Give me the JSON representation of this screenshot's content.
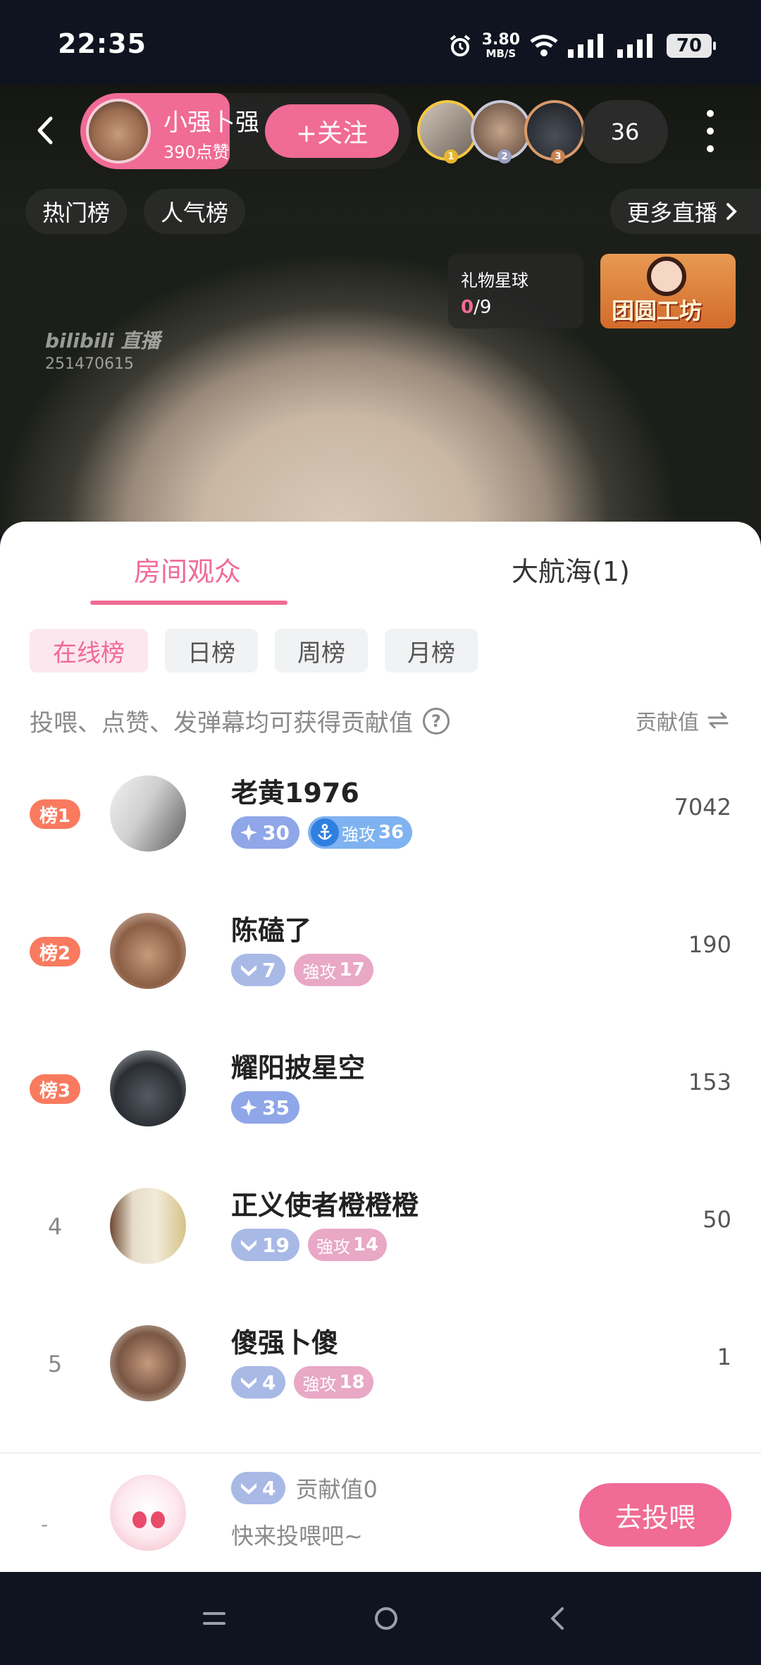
{
  "status_bar": {
    "time": "22:35",
    "net_speed": "3.80",
    "net_unit": "MB/S",
    "battery": "70"
  },
  "header": {
    "streamer_name": "小强卜强",
    "likes": "390点赞",
    "follow_label": "+关注",
    "viewer_count": "36",
    "medals": [
      "1",
      "2",
      "3"
    ]
  },
  "chips": {
    "hot": "热门榜",
    "popular": "人气榜",
    "more_live": "更多直播"
  },
  "gift_planet": {
    "title": "礼物星球",
    "current": "0",
    "total": "/9"
  },
  "promo": {
    "text": "团圆工坊"
  },
  "watermark": {
    "logo": "bilibili 直播",
    "room_id": "251470615"
  },
  "tabs": {
    "audience": "房间观众",
    "fleet": "大航海(1)"
  },
  "subtabs": {
    "online": "在线榜",
    "day": "日榜",
    "week": "周榜",
    "month": "月榜"
  },
  "hint": "投喂、点赞、发弹幕均可获得贡献值",
  "sort_label": "贡献值",
  "rows": [
    {
      "rank_label": "榜1",
      "name": "老黄1976",
      "fan_level": "30",
      "guard_label": "強攻",
      "guard_level": "36",
      "score": "7042"
    },
    {
      "rank_label": "榜2",
      "name": "陈磕了",
      "fan_level": "7",
      "guard_label": "強攻",
      "guard_level": "17",
      "score": "190"
    },
    {
      "rank_label": "榜3",
      "name": "耀阳披星空",
      "fan_level": "35",
      "score": "153"
    },
    {
      "rank_label": "4",
      "name": "正义使者橙橙橙",
      "fan_level": "19",
      "guard_label": "強攻",
      "guard_level": "14",
      "score": "50"
    },
    {
      "rank_label": "5",
      "name": "傻强卜傻",
      "fan_level": "4",
      "guard_label": "強攻",
      "guard_level": "18",
      "score": "1"
    }
  ],
  "me": {
    "rank": "-",
    "fan_level": "4",
    "contribution": "贡献值0",
    "subtitle": "快来投喂吧~",
    "button": "去投喂"
  },
  "colors": {
    "accent": "#f06b95",
    "rank_badge": "#f97a5f",
    "fan_badge": "#a8b9e6",
    "guard_badge": "#e8a8c6"
  }
}
